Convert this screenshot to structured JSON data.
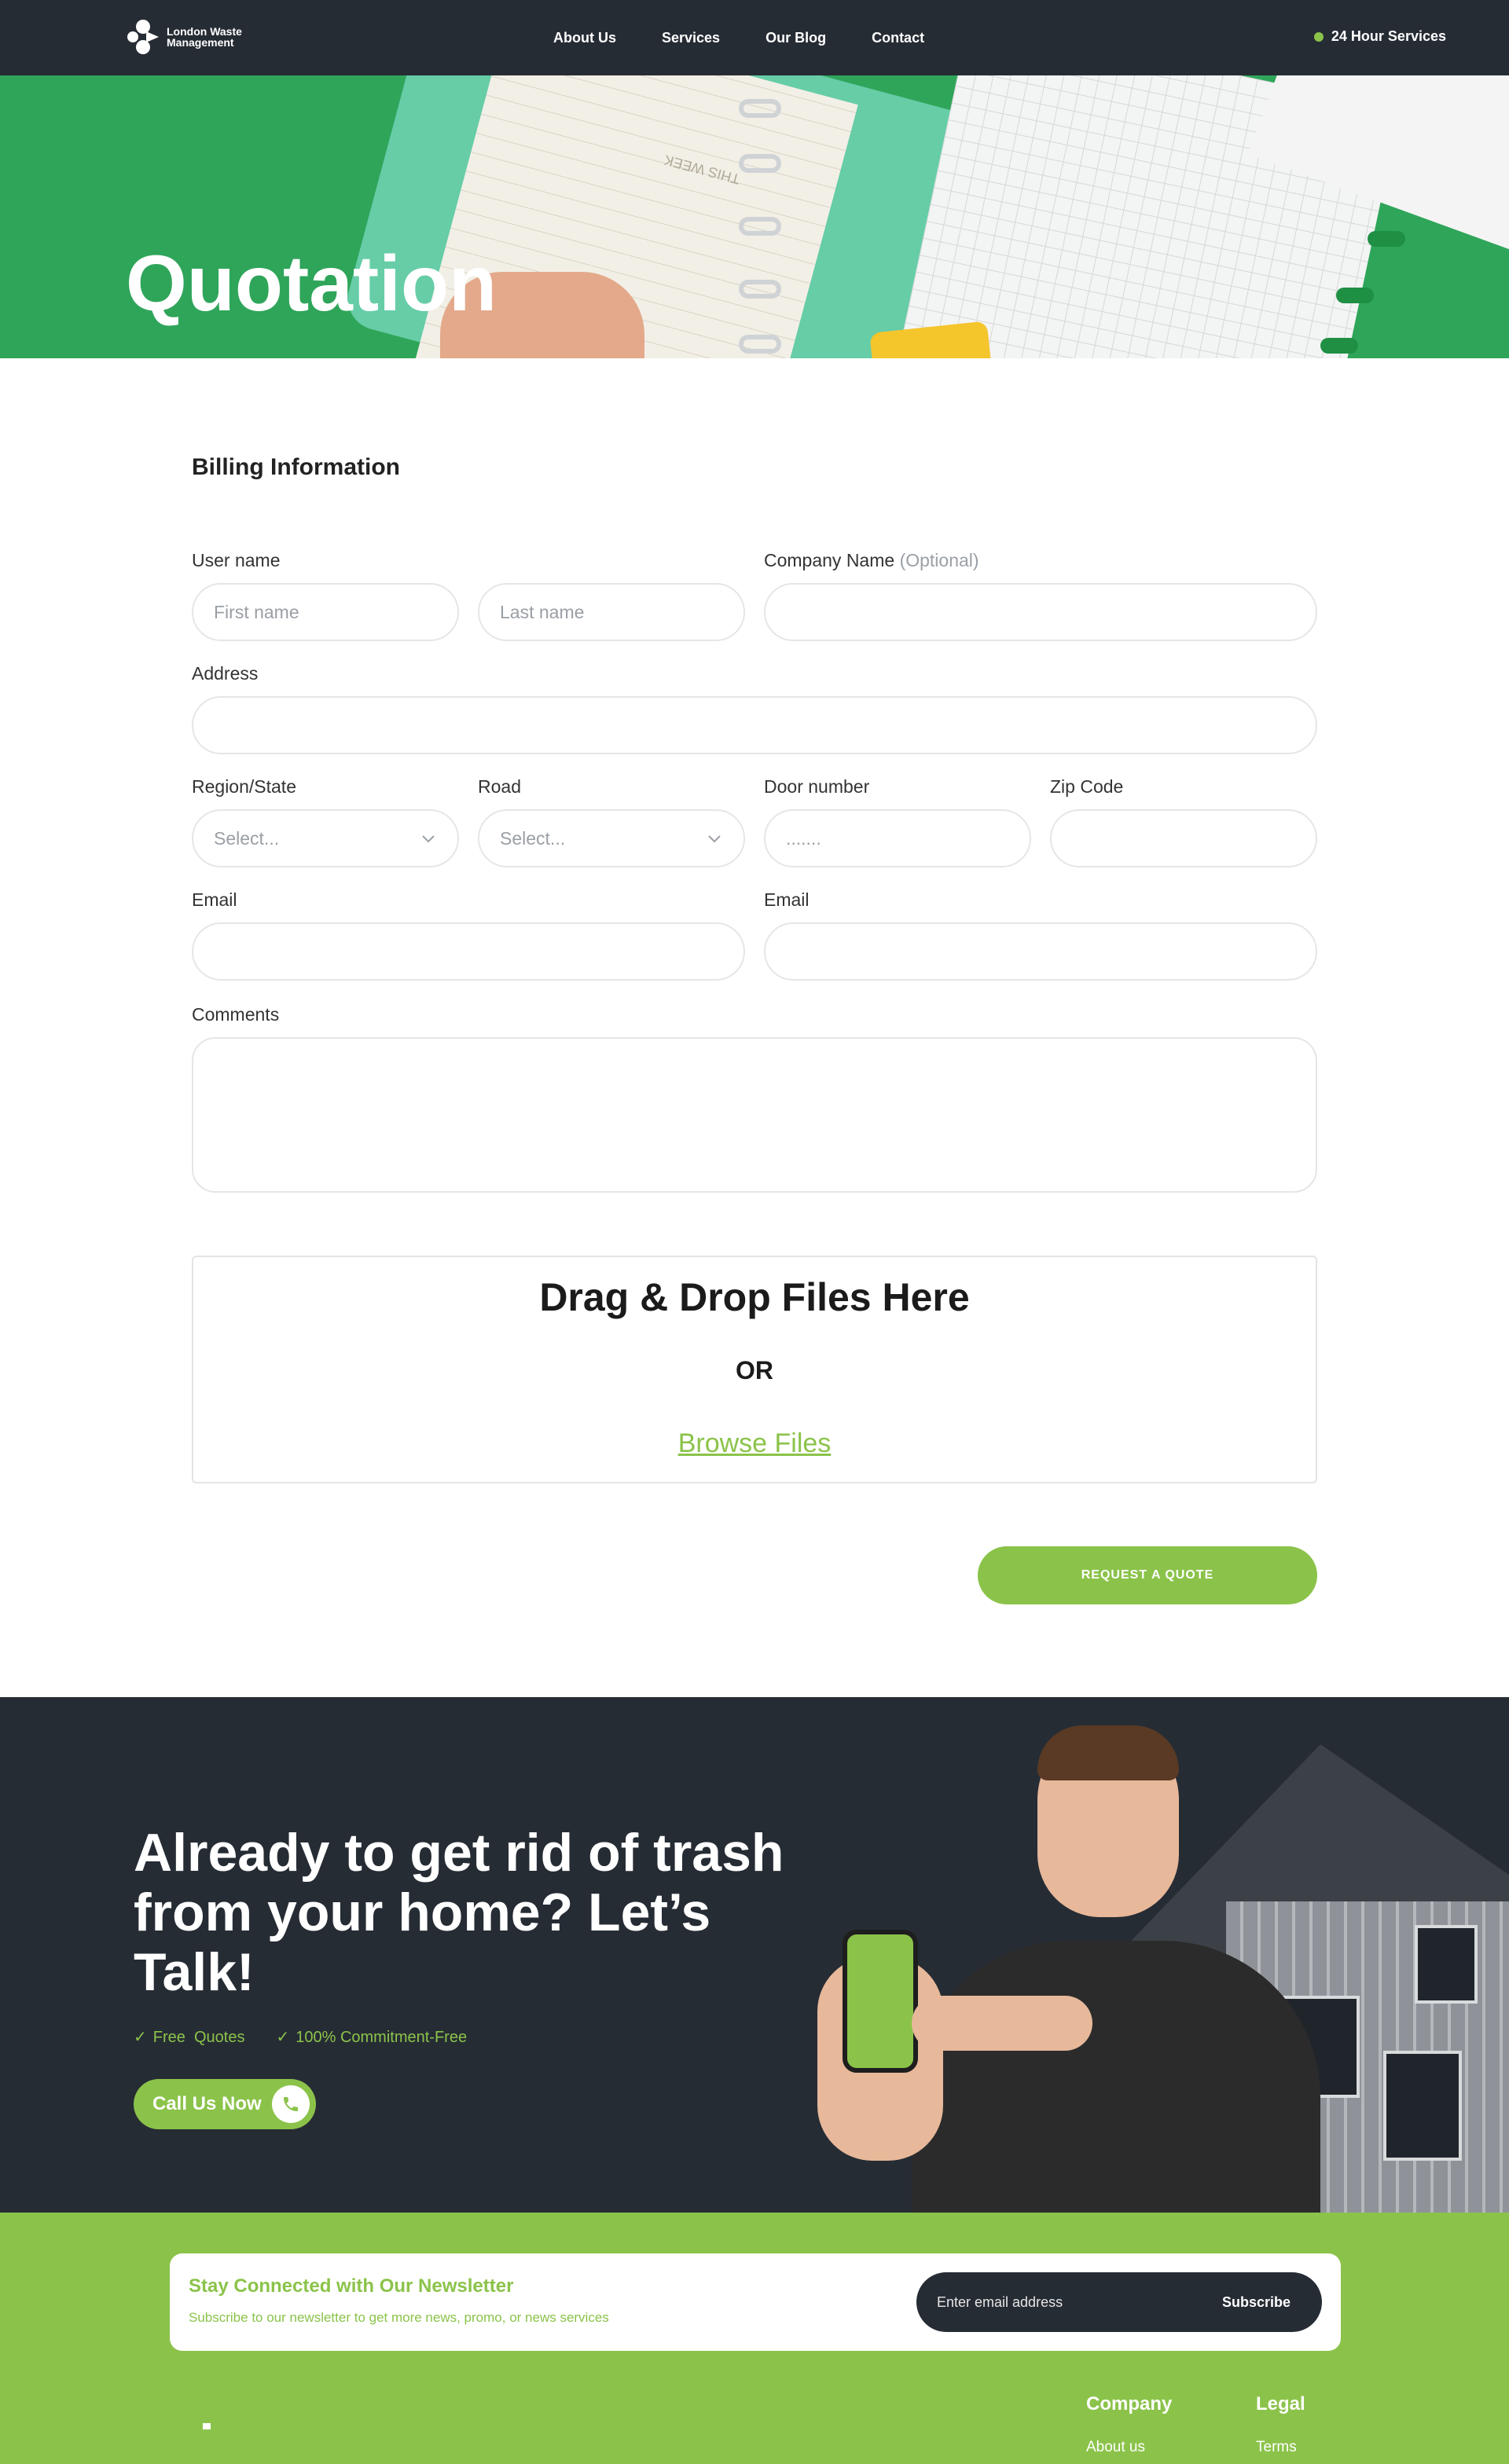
{
  "header": {
    "logo_text": "London Waste Management",
    "nav": [
      "About Us",
      "Services",
      "Our Blog",
      "Contact"
    ],
    "hours_label": "24 Hour Services"
  },
  "hero": {
    "title": "Quotation",
    "paper_text": "THIS WEEK"
  },
  "form": {
    "section_title": "Billing Information",
    "username_label": "User name",
    "first_name_placeholder": "First name",
    "last_name_placeholder": "Last name",
    "company_label": "Company Name",
    "company_optional": "(Optional)",
    "address_label": "Address",
    "region_label": "Region/State",
    "region_placeholder": "Select...",
    "road_label": "Road",
    "road_placeholder": "Select...",
    "door_label": "Door number",
    "door_placeholder": ".......",
    "zip_label": "Zip Code",
    "email_label_1": "Email",
    "email_label_2": "Email",
    "comments_label": "Comments"
  },
  "dropzone": {
    "title": "Drag & Drop Files Here",
    "or": "OR",
    "browse": "Browse Files"
  },
  "submit_label": "REQUEST A QUOTE",
  "cta": {
    "title": "Already to get rid of trash from your home? Let’s Talk!",
    "checks": [
      "Free  Quotes",
      "100% Commitment-Free"
    ],
    "call_label": "Call Us Now"
  },
  "newsletter": {
    "title": "Stay Connected with Our Newsletter",
    "subtitle": "Subscribe to our newsletter to get more news, promo, or news services",
    "email_placeholder": "Enter email address",
    "button": "Subscribe"
  },
  "footer": {
    "company_heading": "Company",
    "company_link": "About us",
    "legal_heading": "Legal",
    "legal_link": "Terms"
  },
  "colors": {
    "accent": "#8bc34a",
    "dark": "#262c34",
    "hero_green": "#2fa55a"
  }
}
